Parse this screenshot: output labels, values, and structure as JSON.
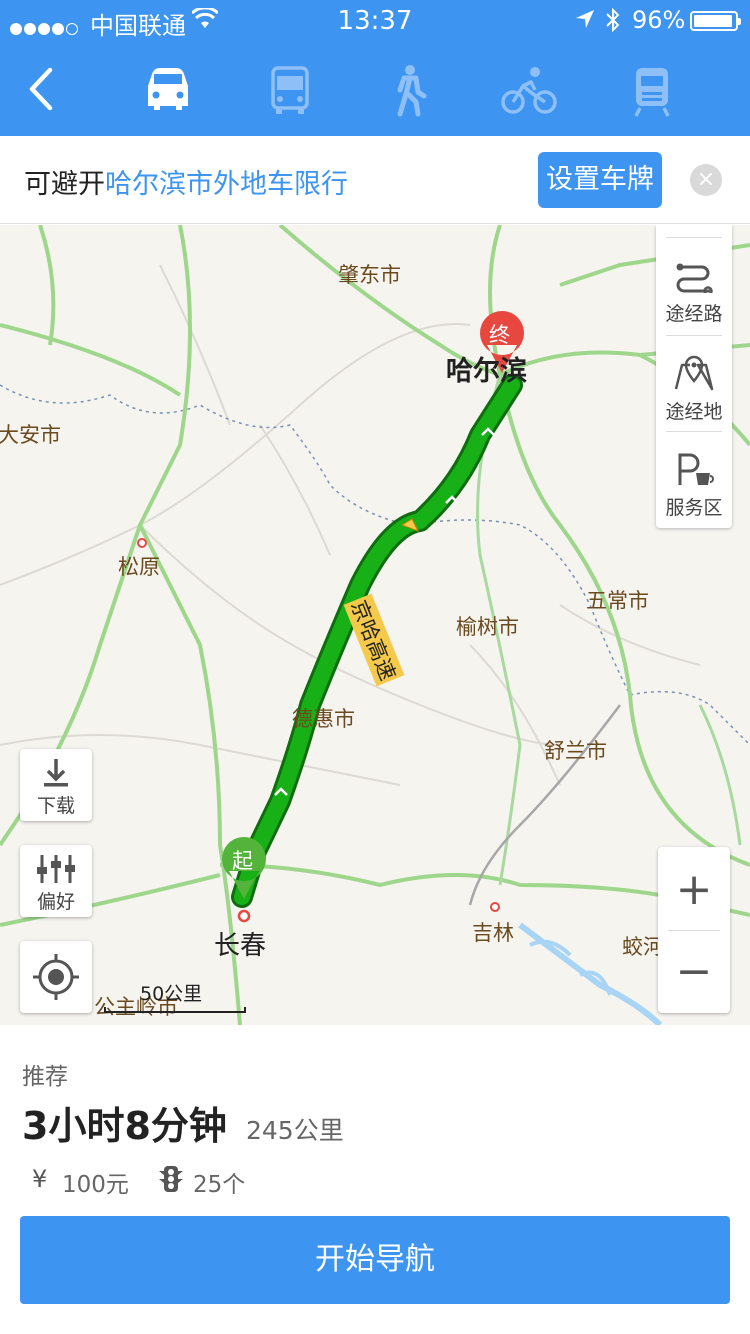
{
  "status_bar": {
    "carrier": "中国联通",
    "time": "13:37",
    "battery": "96%"
  },
  "nav": {
    "back_icon": "chevron-left-icon",
    "modes": [
      "car-icon",
      "bus-icon",
      "walk-icon",
      "bike-icon",
      "train-icon"
    ],
    "selected_mode": "car"
  },
  "restriction": {
    "prefix": "可避开",
    "link": "哈尔滨市外地车限行",
    "plate_button": "设置车牌",
    "close_icon": "close-icon"
  },
  "map": {
    "cities": {
      "zhaodong": "肇东市",
      "harbin": "哈尔滨",
      "daan": "大安市",
      "songyuan": "松原",
      "wuchang": "五常市",
      "yushu": "榆树市",
      "dehui": "德惠市",
      "shulan": "舒兰市",
      "changchun": "长春",
      "jilin": "吉林",
      "jiaohe": "蛟河市",
      "gongzhuling": "公主岭市"
    },
    "highway_label": "京哈高速",
    "start_marker": "起",
    "end_marker": "终",
    "side_panel": {
      "waypoint_road": "途经路",
      "waypoint_place": "途经地",
      "service_area": "服务区"
    },
    "download": "下载",
    "preference": "偏好",
    "scale": "50公里",
    "zoom_in": "+",
    "zoom_out": "−"
  },
  "route": {
    "tag": "推荐",
    "duration": "3小时8分钟",
    "distance": "245公里",
    "fee_icon": "¥",
    "fee": "100元",
    "lights": "25个",
    "start_button": "开始导航"
  },
  "colors": {
    "primary": "#3d94f1",
    "route": "#17b117",
    "end_marker": "#e8473f",
    "start_marker": "#53b33a"
  }
}
